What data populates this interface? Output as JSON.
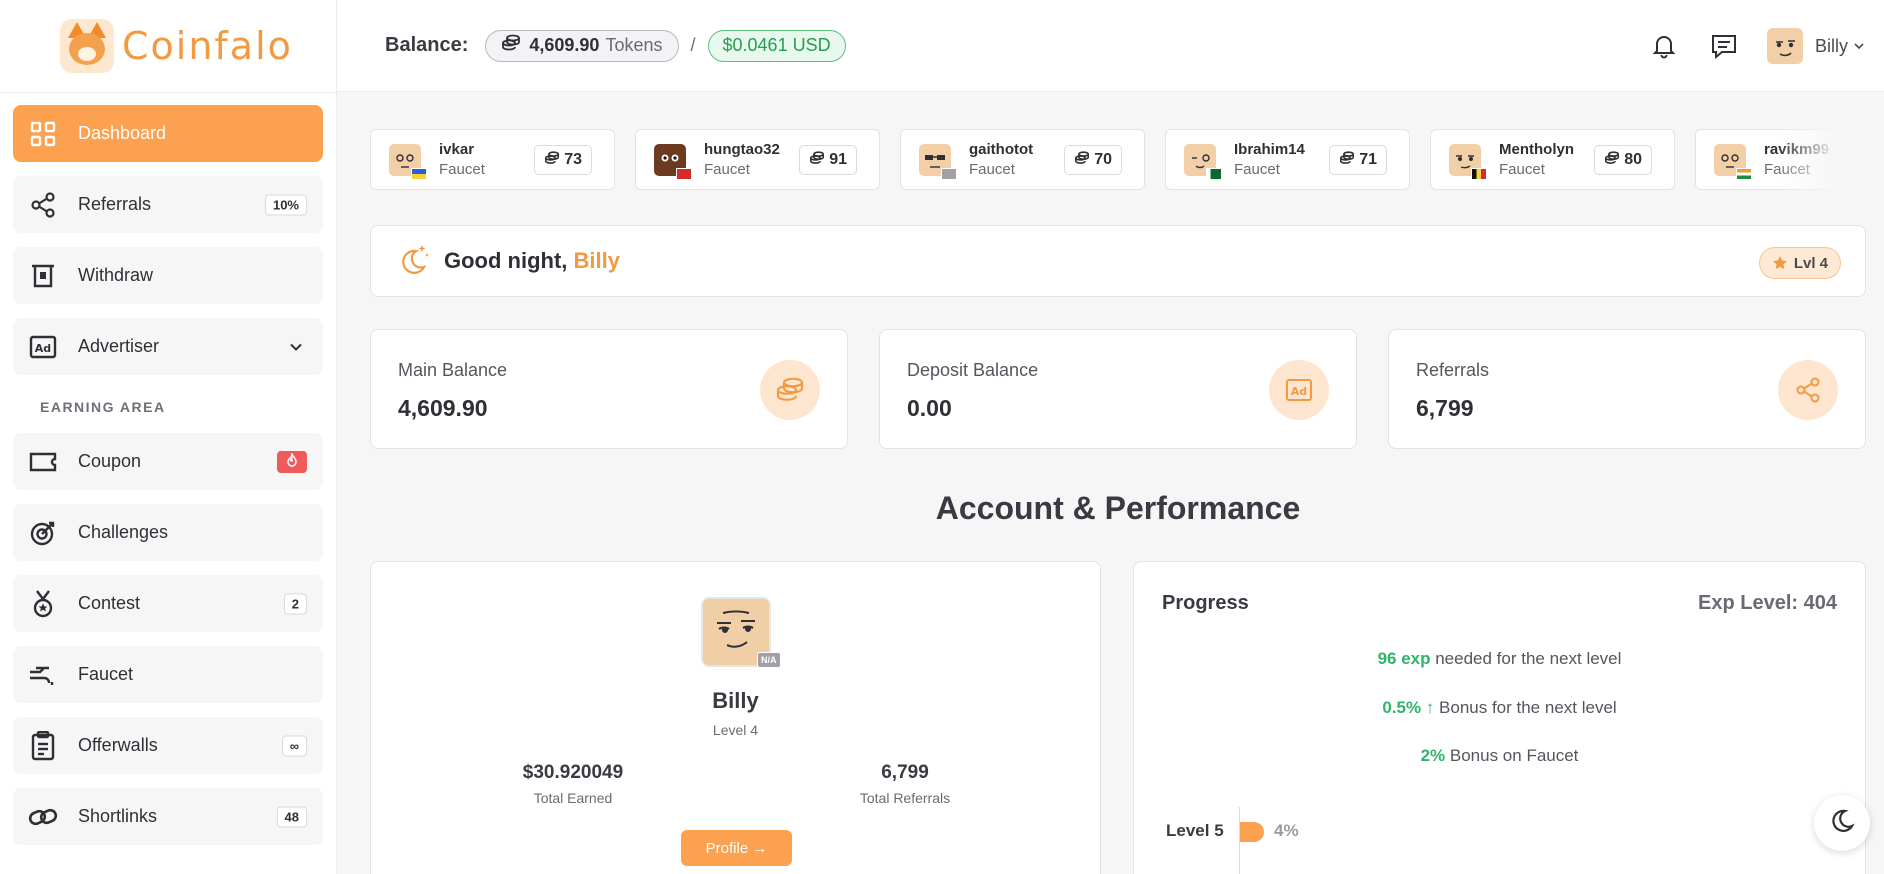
{
  "brand": {
    "name": "Coinfalo"
  },
  "sidebar": {
    "items": [
      {
        "label": "Dashboard",
        "icon": "dashboard-grid-icon",
        "badge": ""
      },
      {
        "label": "Referrals",
        "icon": "share-icon",
        "badge": "10%"
      },
      {
        "label": "Withdraw",
        "icon": "withdraw-icon",
        "badge": ""
      },
      {
        "label": "Advertiser",
        "icon": "ad-icon",
        "badge": ""
      }
    ],
    "section_label": "EARNING AREA",
    "earning_items": [
      {
        "label": "Coupon",
        "icon": "ticket-icon",
        "badge": ""
      },
      {
        "label": "Challenges",
        "icon": "target-icon",
        "badge": ""
      },
      {
        "label": "Contest",
        "icon": "medal-icon",
        "badge": "2"
      },
      {
        "label": "Faucet",
        "icon": "faucet-icon",
        "badge": ""
      },
      {
        "label": "Offerwalls",
        "icon": "clipboard-icon",
        "badge": "∞"
      },
      {
        "label": "Shortlinks",
        "icon": "link-icon",
        "badge": "48"
      }
    ]
  },
  "header": {
    "balance_label": "Balance:",
    "tokens_value": "4,609.90",
    "tokens_unit": "Tokens",
    "separator": "/",
    "usd_value": "$0.0461 USD",
    "user_name": "Billy"
  },
  "leaderboard": [
    {
      "name": "ivkar",
      "source": "Faucet",
      "score": "73",
      "flag": "ukraine"
    },
    {
      "name": "hungtao32",
      "source": "Faucet",
      "score": "91",
      "flag": "vietnam"
    },
    {
      "name": "gaithotot",
      "source": "Faucet",
      "score": "70",
      "flag": "n/a"
    },
    {
      "name": "Ibrahim14",
      "source": "Faucet",
      "score": "71",
      "flag": "pakistan"
    },
    {
      "name": "Mentholyn",
      "source": "Faucet",
      "score": "80",
      "flag": "belgium"
    },
    {
      "name": "ravikm99",
      "source": "Faucet",
      "score": "",
      "flag": "india"
    }
  ],
  "greeting": {
    "prefix": "Good night,",
    "name": "Billy",
    "level_badge": "Lvl 4"
  },
  "stats": [
    {
      "label": "Main Balance",
      "value": "4,609.90",
      "icon": "coins-icon"
    },
    {
      "label": "Deposit Balance",
      "value": "0.00",
      "icon": "ad-icon"
    },
    {
      "label": "Referrals",
      "value": "6,799",
      "icon": "share-icon"
    }
  ],
  "section_title": "Account & Performance",
  "profile": {
    "name": "Billy",
    "level": "Level 4",
    "avatar_badge": "N/A",
    "total_earned_value": "$30.920049",
    "total_earned_label": "Total Earned",
    "total_referrals_value": "6,799",
    "total_referrals_label": "Total Referrals",
    "button_label": "Profile →"
  },
  "progress": {
    "title": "Progress",
    "exp_level": "Exp Level: 404",
    "lines": [
      {
        "highlight": "96 exp",
        "text": " needed for the next level"
      },
      {
        "highlight": "0.5% ↑",
        "text": " Bonus for the next level"
      },
      {
        "highlight": "2%",
        "text": " Bonus on Faucet"
      }
    ],
    "level_label": "Level 5",
    "level_percent_text": "4%",
    "level_fraction": 0.04
  },
  "colors": {
    "accent": "#fba14f",
    "success": "#2fb46a"
  }
}
